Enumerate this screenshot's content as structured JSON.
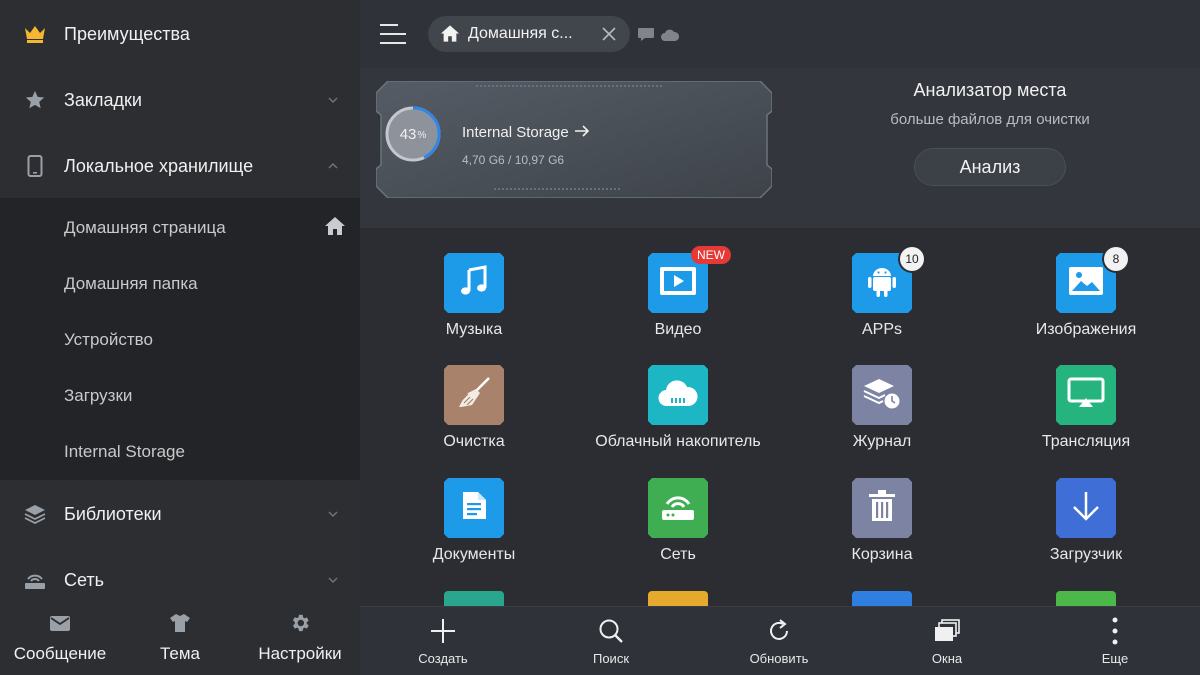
{
  "sidebar": {
    "items": [
      {
        "label": "Преимущества",
        "icon": "crown-icon"
      },
      {
        "label": "Закладки",
        "icon": "star-icon",
        "expanded": false
      },
      {
        "label": "Локальное хранилище",
        "icon": "phone-icon",
        "expanded": true
      },
      {
        "label": "Библиотеки",
        "icon": "layers-icon",
        "expanded": false
      },
      {
        "label": "Сеть",
        "icon": "network-icon",
        "expanded": false
      }
    ],
    "local_sub": [
      {
        "label": "Домашняя страница"
      },
      {
        "label": "Домашняя папка"
      },
      {
        "label": "Устройство"
      },
      {
        "label": "Загрузки"
      },
      {
        "label": "Internal Storage"
      }
    ],
    "footer": [
      {
        "label": "Сообщение",
        "icon": "mail-icon"
      },
      {
        "label": "Тема",
        "icon": "shirt-icon"
      },
      {
        "label": "Настройки",
        "icon": "gear-icon"
      }
    ]
  },
  "topbar": {
    "tab_label": "Домашняя с..."
  },
  "storage": {
    "percent": "43",
    "percent_sign": "%",
    "percent_value": 0.43,
    "title": "Internal Storage",
    "size": "4,70 G6 / 10,97 G6"
  },
  "analyzer": {
    "title": "Анализатор места",
    "subtitle": "больше файлов для очистки",
    "button": "Анализ"
  },
  "grid": {
    "items": [
      {
        "label": "Музыка",
        "icon": "music-icon",
        "color": "#1e9be8"
      },
      {
        "label": "Видео",
        "icon": "video-icon",
        "color": "#1e9be8",
        "badge": "NEW"
      },
      {
        "label": "APPs",
        "icon": "android-icon",
        "color": "#1e9be8",
        "count": "10"
      },
      {
        "label": "Изображения",
        "icon": "image-icon",
        "color": "#1e9be8",
        "count": "8"
      },
      {
        "label": "Очистка",
        "icon": "broom-icon",
        "color": "#a8826b"
      },
      {
        "label": "Облачный накопитель",
        "icon": "cloud-icon",
        "color": "#1cb6c4"
      },
      {
        "label": "Журнал",
        "icon": "history-icon",
        "color": "#7c83a3"
      },
      {
        "label": "Трансляция",
        "icon": "cast-icon",
        "color": "#25b47e"
      },
      {
        "label": "Документы",
        "icon": "document-icon",
        "color": "#1e9be8"
      },
      {
        "label": "Сеть",
        "icon": "router-icon",
        "color": "#3fae53"
      },
      {
        "label": "Корзина",
        "icon": "trash-icon",
        "color": "#7c83a3"
      },
      {
        "label": "Загрузчик",
        "icon": "download-icon",
        "color": "#3f6fd6"
      }
    ],
    "peek_colors": [
      "#2aa68f",
      "#e5a92d",
      "#2f7fe0",
      "#4cb84a"
    ]
  },
  "bottombar": {
    "items": [
      {
        "label": "Создать",
        "icon": "plus-icon"
      },
      {
        "label": "Поиск",
        "icon": "search-icon"
      },
      {
        "label": "Обновить",
        "icon": "refresh-icon"
      },
      {
        "label": "Окна",
        "icon": "windows-icon"
      },
      {
        "label": "Еще",
        "icon": "more-icon"
      }
    ]
  }
}
